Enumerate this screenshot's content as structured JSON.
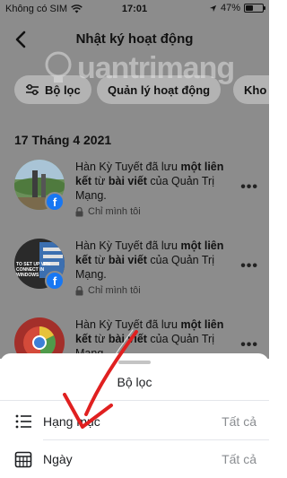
{
  "status_bar": {
    "carrier": "Không có SIM",
    "time": "17:01",
    "battery": "47%",
    "battery_level": 0.47
  },
  "header": {
    "title": "Nhật ký hoạt động",
    "back_icon": "chevron-left-icon"
  },
  "filters": {
    "chips": [
      {
        "label": "Bộ lọc",
        "icon": "sliders-icon"
      },
      {
        "label": "Quản lý hoạt động"
      },
      {
        "label": "Kho"
      }
    ]
  },
  "feed": {
    "date": "17 Tháng 4 2021",
    "items": [
      {
        "pre": "Hàn Kỳ Tuyết đã lưu ",
        "bold1": "một liên kết",
        "mid": " từ ",
        "bold2": "bài viết",
        "post": " của Quản Trị Mạng.",
        "privacy": "Chỉ mình tôi"
      },
      {
        "pre": "Hàn Kỳ Tuyết đã lưu ",
        "bold1": "một liên kết",
        "mid": " từ ",
        "bold2": "bài viết",
        "post": " của Quản Trị Mạng.",
        "privacy": "Chỉ mình tôi",
        "thumb_text": "TO SET UP VPN CONNECT IN WINDOWS"
      },
      {
        "pre": "Hàn Kỳ Tuyết đã lưu ",
        "bold1": "một liên kết",
        "mid": " từ ",
        "bold2": "bài viết",
        "post": " của Quản Trị Mạng."
      }
    ],
    "more_label": "•••"
  },
  "sheet": {
    "title": "Bộ lọc",
    "options": [
      {
        "label": "Hạng mục",
        "value": "Tất cả",
        "icon": "list-icon"
      },
      {
        "label": "Ngày",
        "value": "Tất cả",
        "icon": "calendar-icon"
      }
    ]
  },
  "watermark": {
    "text": "uantrimang"
  },
  "colors": {
    "overlay_gray": "#8c8c8c",
    "chip_gray": "#b3b3b3",
    "facebook_blue": "#1877f2",
    "annotation_red": "#e02020"
  }
}
